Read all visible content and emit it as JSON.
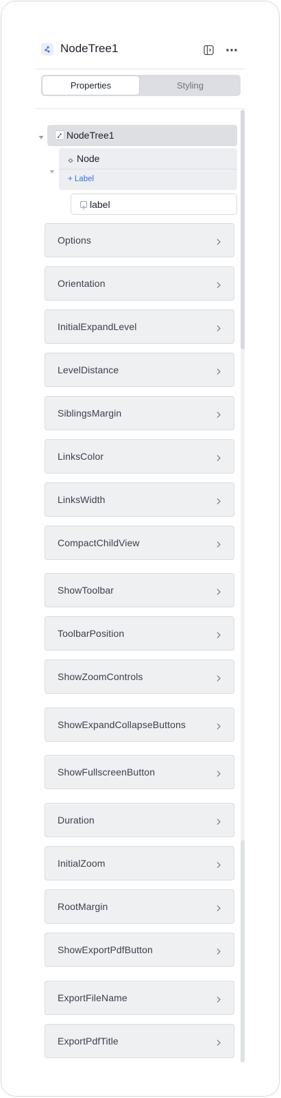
{
  "header": {
    "title": "NodeTree1",
    "icons": {
      "logo": "node-tree-icon",
      "panel": "panel-toggle-icon",
      "more": "more-horizontal-icon"
    }
  },
  "tabs": [
    {
      "label": "Properties",
      "active": true
    },
    {
      "label": "Styling",
      "active": false
    }
  ],
  "tree": {
    "root": {
      "label": "NodeTree1",
      "expanded": true
    },
    "node": {
      "label": "Node",
      "expanded": true,
      "add_label": "+ Label"
    },
    "leaf": {
      "label": "label"
    }
  },
  "properties": [
    "Options",
    "Orientation",
    "InitialExpandLevel",
    "LevelDistance",
    "SiblingsMargin",
    "LinksColor",
    "LinksWidth",
    "CompactChildView",
    "ShowToolbar",
    "ToolbarPosition",
    "ShowZoomControls",
    "ShowExpandCollapseButtons",
    "ShowFullscreenButton",
    "Duration",
    "InitialZoom",
    "RootMargin",
    "ShowExportPdfButton",
    "ExportFileName",
    "ExportPdfTitle"
  ],
  "colors": {
    "accent_link": "#3b73d9",
    "row_bg": "#eff0f2",
    "selected_bg": "#dddfe3"
  }
}
